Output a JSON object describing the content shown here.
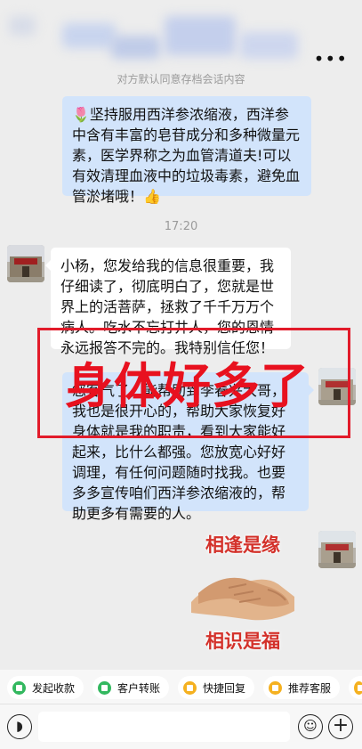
{
  "header": {
    "notice": "对方默认同意存档会话内容",
    "more_icon": "more-dots-icon"
  },
  "messages": {
    "m1": {
      "text": "🌷坚持服用西洋参浓缩液，西洋参中含有丰富的皂苷成分和多种微量元素，医学界称之为血管清道夫!可以有效清理血液中的垃圾毒素，避免血管淤堵哦！👍"
    },
    "time": "17:20",
    "m2": {
      "text": "小杨，您发给我的信息很重要，我仔细读了，彻底明白了，您就是世界上的活菩萨，拯救了千千万万个病人。吃水不忘打井人，您的恩情永远报答不完的。我特别信任您！"
    },
    "m3": {
      "text": "您客气了，能帮助到李春兴大哥，我也是很开心的，帮助大家恢复好身体就是我的职责，看到大家能好起来，比什么都强。您放宽心好好调理，有任何问题随时找我。也要多多宣传咱们西洋参浓缩液的，帮助更多有需要的人。"
    },
    "sticker": {
      "top": "相逢是缘",
      "bottom": "相识是福"
    }
  },
  "overlay": {
    "text": "身体好多了",
    "color": "#e8111f"
  },
  "quick_actions": [
    {
      "label": "发起收款",
      "icon": "payment-icon"
    },
    {
      "label": "客户转账",
      "icon": "transfer-icon"
    },
    {
      "label": "快捷回复",
      "icon": "quick-reply-icon"
    },
    {
      "label": "推荐客服",
      "icon": "recommend-icon"
    }
  ],
  "input": {
    "placeholder": ""
  },
  "colors": {
    "bubble_blue": "#d2e4fb",
    "bubble_white": "#ffffff",
    "background": "#ededed",
    "accent_green": "#33b85f",
    "accent_yellow": "#f5b120"
  }
}
